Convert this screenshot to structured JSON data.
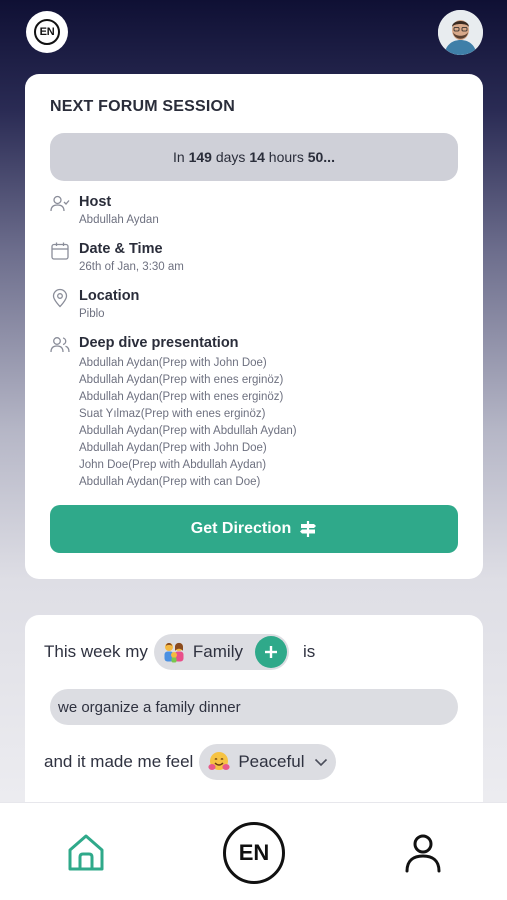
{
  "header": {
    "logo_text": "EN"
  },
  "forum": {
    "title": "NEXT FORUM SESSION",
    "countdown": {
      "prefix": "In",
      "days": "149",
      "days_label": "days",
      "hours": "14",
      "hours_label": "hours",
      "rest": "50..."
    },
    "host_label": "Host",
    "host_value": "Abdullah Aydan",
    "datetime_label": "Date & Time",
    "datetime_value": "26th of Jan, 3:30 am",
    "location_label": "Location",
    "location_value": "Piblo",
    "presentation_label": "Deep dive presentation",
    "presentations": [
      "Abdullah Aydan(Prep with John Doe)",
      "Abdullah Aydan(Prep with enes erginöz)",
      "Abdullah Aydan(Prep with enes erginöz)",
      "Suat Yılmaz(Prep with enes erginöz)",
      "Abdullah Aydan(Prep with Abdullah Aydan)",
      "Abdullah Aydan(Prep with John Doe)",
      "John Doe(Prep with Abdullah Aydan)",
      "Abdullah Aydan(Prep with can Doe)"
    ],
    "direction_button": "Get Direction",
    "accent_color": "#2fa98a"
  },
  "weekly": {
    "line1_prefix": "This week my",
    "topic_chip": "Family",
    "topic_icon": "family-emoji",
    "line1_suffix": "is",
    "input_value": "we organize a family dinner",
    "line3_prefix": "and it made me feel",
    "feeling_chip": "Peaceful",
    "feeling_icon": "hugging-face-emoji"
  },
  "bottom_nav": {
    "home_icon": "home-icon",
    "center_text": "EN",
    "profile_icon": "user-icon"
  }
}
